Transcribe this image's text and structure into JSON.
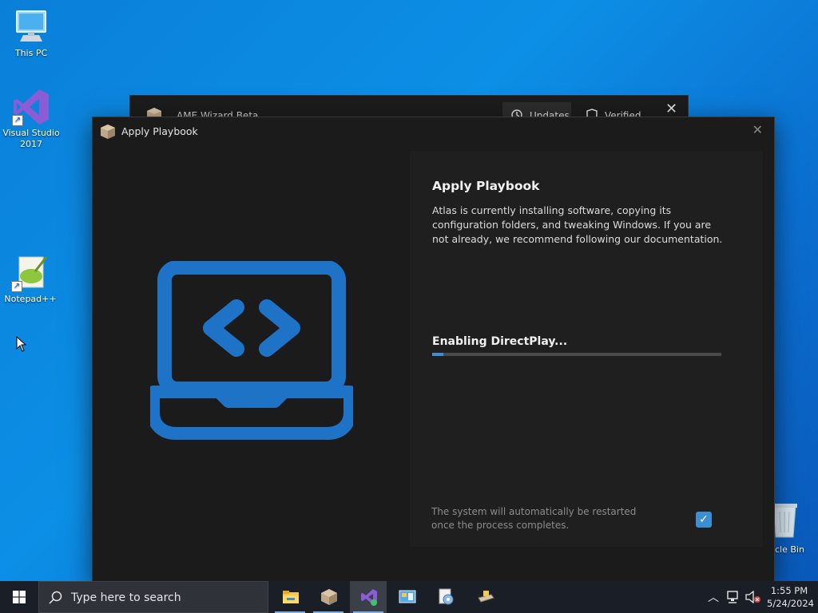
{
  "desktop": {
    "icons": [
      {
        "label": "This PC"
      },
      {
        "label": "Visual Studio 2017"
      },
      {
        "label": "Notepad++"
      },
      {
        "label": "cle Bin"
      }
    ]
  },
  "back_window": {
    "title": "AME Wizard Beta",
    "tabs": [
      {
        "label": "Updates"
      },
      {
        "label": "Verified"
      }
    ],
    "close_glyph": "✕"
  },
  "window": {
    "title": "Apply Playbook",
    "close_glyph": "✕",
    "heading": "Apply Playbook",
    "description": "Atlas is currently installing software, copying its configuration folders, and tweaking Windows. If you are not already, we recommend following our documentation.",
    "status": "Enabling DirectPlay...",
    "progress_fraction": 0.04,
    "restart_note": "The system will automatically be restarted once the process completes.",
    "restart_checked": true,
    "accent_color": "#3a8fd8"
  },
  "taskbar": {
    "search_placeholder": "Type here to search",
    "apps": [
      {
        "icon": "file-explorer-icon"
      },
      {
        "icon": "ame-wizard-icon"
      },
      {
        "icon": "visual-studio-icon"
      },
      {
        "icon": "control-panel-icon"
      },
      {
        "icon": "windows-media-player-icon"
      },
      {
        "icon": "scanner-icon"
      }
    ],
    "clock": {
      "time": "1:55 PM",
      "date": "5/24/2024"
    }
  }
}
